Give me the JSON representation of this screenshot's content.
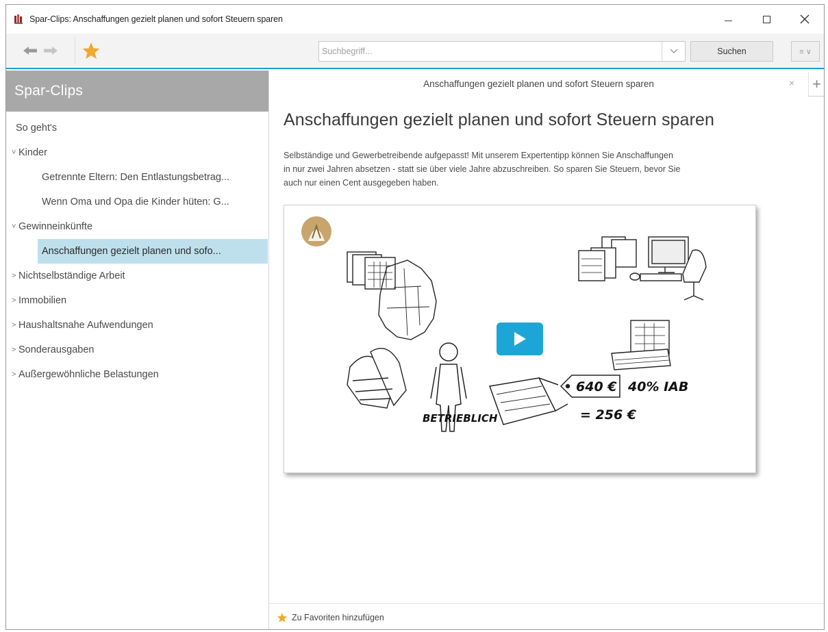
{
  "window": {
    "title": "Spar-Clips: Anschaffungen gezielt planen und sofort Steuern sparen",
    "controls": {
      "minimize": "—",
      "maximize": "☐",
      "close": "✕"
    }
  },
  "toolbar": {
    "search_placeholder": "Suchbegriff...",
    "search_button": "Suchen",
    "menu_icon": "≡ ∨"
  },
  "sidebar": {
    "header": "Spar-Clips",
    "items": [
      {
        "label": "So geht's",
        "caret": ""
      },
      {
        "label": "Kinder",
        "caret": "˅"
      },
      {
        "label": "Getrennte Eltern: Den Entlastungsbetrag...",
        "caret": ""
      },
      {
        "label": "Wenn Oma und Opa die Kinder hüten: G...",
        "caret": ""
      },
      {
        "label": "Gewinneinkünfte",
        "caret": "˅"
      },
      {
        "label": "Anschaffungen gezielt planen und sofo...",
        "caret": ""
      },
      {
        "label": "Nichtselbständige Arbeit",
        "caret": ">"
      },
      {
        "label": "Immobilien",
        "caret": ">"
      },
      {
        "label": "Haushaltsnahe Aufwendungen",
        "caret": ">"
      },
      {
        "label": "Sonderausgaben",
        "caret": ">"
      },
      {
        "label": "Außergewöhnliche Belastungen",
        "caret": ">"
      }
    ]
  },
  "content": {
    "tab_title": "Anschaffungen gezielt planen und sofort Steuern sparen",
    "tab_close": "×",
    "tab_add": "+",
    "article_title": "Anschaffungen gezielt planen und sofort Steuern sparen",
    "article_lines": [
      "Selbständige und Gewerbetreibende aufgepasst! Mit unserem Expertentipp können Sie Anschaffungen",
      "in nur zwei Jahren absetzen - statt sie über viele Jahre abzuschreiben. So sparen Sie Steuern, bevor Sie",
      "auch nur einen Cent ausgegeben haben."
    ],
    "video": {
      "price": "640 €",
      "iab": "40% IAB",
      "result": "= 256 €",
      "label_betrieblich": "BETRIEBLICH"
    },
    "footer_label": "Zu Favoriten hinzufügen"
  },
  "colors": {
    "accent": "#1f9bd4",
    "play": "#1ea5d8",
    "selected_bg": "#bde0ec",
    "sidebar_header_bg": "#a8a8a8",
    "star": "#f0a830"
  }
}
